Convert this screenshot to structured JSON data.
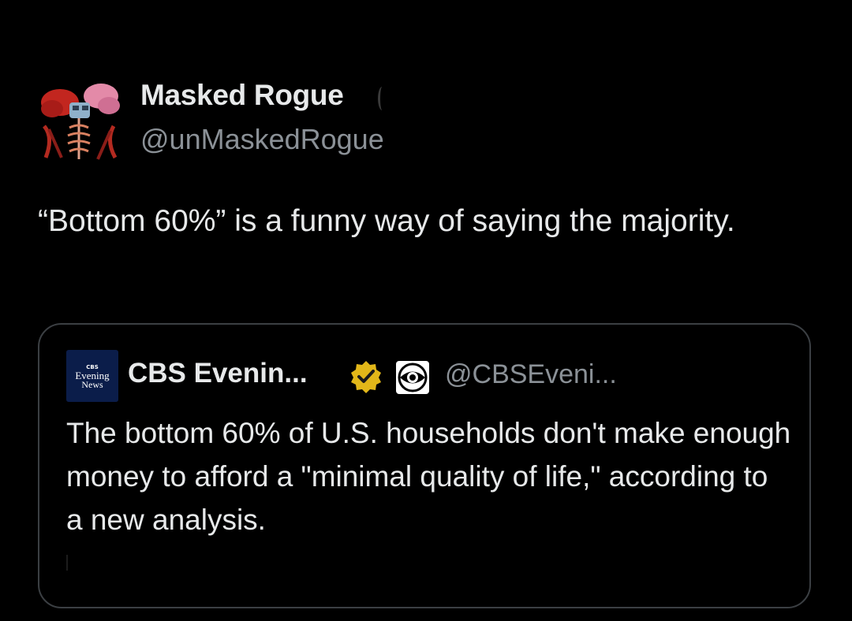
{
  "tweet": {
    "author": {
      "name": "Masked Rogue",
      "handle": "@unMaskedRogue",
      "avatar_icon": "masked-rogue-avatar-icon"
    },
    "text": "“Bottom 60%” is a funny way of saying the majority."
  },
  "quote": {
    "author": {
      "name": "CBS Evenin...",
      "handle": "@CBSEveni...",
      "avatar_label": {
        "top": "CBS",
        "middle": "Evening",
        "bottom": "News"
      },
      "verified_icon": "verified-badge-icon",
      "affiliate_icon": "cbs-eye-icon"
    },
    "text": "The bottom 60% of U.S. households don't make enough money to afford a \"minimal quality of life,\" according to a new analysis."
  },
  "colors": {
    "background": "#000000",
    "primary_text": "#e7e9ea",
    "secondary_text": "#8b9197",
    "card_border": "#3b3f43",
    "verified_gold": "#e2b719",
    "cbs_navy": "#0b1d4a"
  }
}
